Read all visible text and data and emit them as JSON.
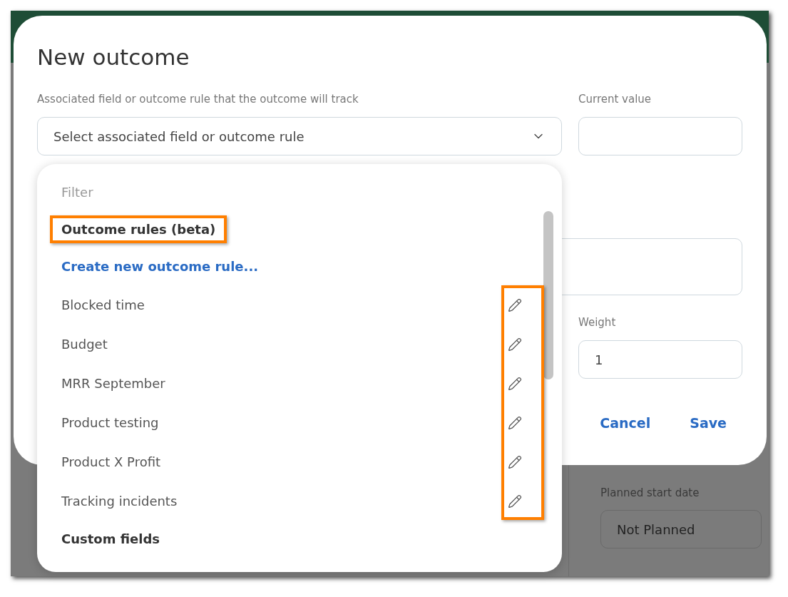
{
  "background": {
    "fields": [
      {
        "label": "Planned start date",
        "value": "Not Planned"
      }
    ]
  },
  "dialog": {
    "title": "New outcome",
    "associated": {
      "label": "Associated field or outcome rule that the outcome will track",
      "placeholder": "Select associated field or outcome rule"
    },
    "current_value": {
      "label": "Current value"
    },
    "weight": {
      "label": "Weight",
      "value": "1"
    },
    "dropdown": {
      "filter": {
        "placeholder": "Filter"
      },
      "edit_highlighted": true,
      "items": [
        {
          "kind": "group",
          "label": "Outcome rules (beta)",
          "highlighted": true
        },
        {
          "kind": "action",
          "label": "Create new outcome rule..."
        },
        {
          "kind": "option",
          "label": "Blocked time"
        },
        {
          "kind": "option",
          "label": "Budget"
        },
        {
          "kind": "option",
          "label": "MRR September"
        },
        {
          "kind": "option",
          "label": "Product testing"
        },
        {
          "kind": "option",
          "label": "Product X Profit"
        },
        {
          "kind": "option",
          "label": "Tracking incidents"
        },
        {
          "kind": "group",
          "label": "Custom fields",
          "highlighted": false
        }
      ]
    },
    "buttons": [
      "Cancel",
      "Save"
    ]
  }
}
